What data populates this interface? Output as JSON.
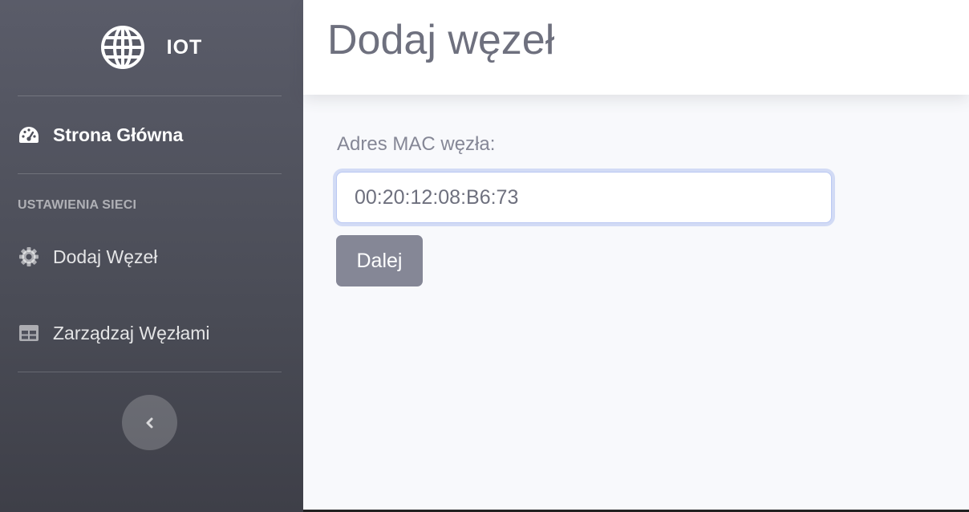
{
  "sidebar": {
    "brand": {
      "icon": "globe-icon",
      "text": "IOT"
    },
    "home": {
      "icon": "tachometer-icon",
      "label": "Strona Główna"
    },
    "section_heading": "USTAWIENIA SIECI",
    "items": [
      {
        "icon": "gear-icon",
        "label": "Dodaj Węzeł"
      },
      {
        "icon": "table-icon",
        "label": "Zarządzaj Węzłami"
      }
    ],
    "toggle": {
      "icon": "chevron-left-icon"
    }
  },
  "topbar": {
    "title": "Dodaj węzeł"
  },
  "form": {
    "mac_label": "Adres MAC węzła:",
    "mac_value": "00:20:12:08:B6:73",
    "submit_label": "Dalej"
  },
  "colors": {
    "sidebar": "#5a5c69",
    "accent": "#4e73df",
    "button": "#858796",
    "page_bg": "#f8f9fc"
  }
}
